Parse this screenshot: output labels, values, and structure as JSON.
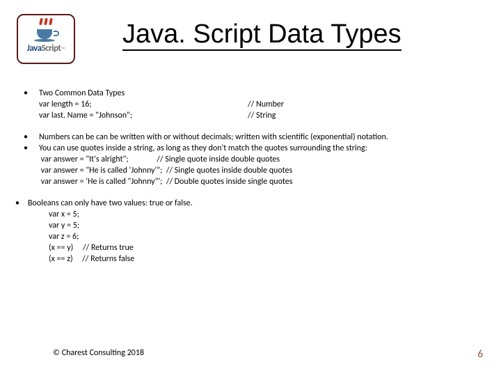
{
  "logo": {
    "word1": "Java",
    "word2": "Script",
    "tm": "™"
  },
  "title": "Java. Script Data Types",
  "b1": {
    "heading": "Two Common Data Types",
    "l1a": " var length = 16;",
    "l1b": " // Number",
    "l2a": " var last. Name = \"Johnson\";",
    "l2b": " // String"
  },
  "b2": "Numbers can be can be written with or without decimals; written with scientific (exponential) notation.",
  "b3": {
    "text": "You can use quotes inside a string, as long as they don't match the quotes surrounding the string:",
    "l1": " var answer = \"It's alright\";               // Single quote inside double quotes",
    "l2": " var answer = \"He is called 'Johnny'\";  // Single quotes inside double quotes",
    "l3": " var answer = 'He is called \"Johnny\"';  // Double quotes inside single quotes"
  },
  "b4": {
    "text": "Booleans can only have two values: true or false.",
    "l1": "var x = 5;",
    "l2": "var y = 5;",
    "l3": "var z = 6;",
    "l4": "(x == y)     // Returns true",
    "l5": "(x == z)     // Returns false"
  },
  "footer": "© Charest Consulting 2018",
  "pagenum": "6"
}
